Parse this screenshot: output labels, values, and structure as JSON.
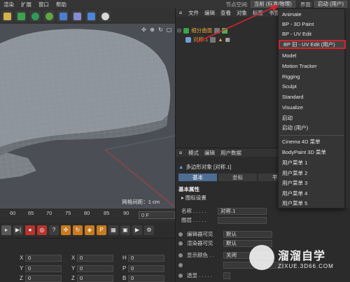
{
  "menubar": {
    "items": [
      "渲染",
      "扩展",
      "窗口",
      "帮助"
    ],
    "node_space_label": "节点空间:",
    "node_space_value": "当前 (标准/物理)",
    "layout_label": "界面:",
    "layout_value": "启动 (用户)"
  },
  "toolbar": {
    "colors": [
      "#d2b04a",
      "#3aa34b",
      "#2f9a5b",
      "#5ca73f",
      "#4a7fd1",
      "#8a8ad0",
      "#4a86d6"
    ]
  },
  "viewport": {
    "grid_info": "网格间距：1 cm",
    "nav_icons": [
      "move-icon",
      "zoom-icon",
      "rotate-icon",
      "maximize-icon"
    ]
  },
  "timeline": {
    "ticks": [
      "60",
      "65",
      "70",
      "75",
      "80",
      "85",
      "90"
    ],
    "frame_value": "0 F"
  },
  "coords": {
    "rows": [
      {
        "a1": "X",
        "v1": "0",
        "a2": "X",
        "v2": "0",
        "a3": "H",
        "v3": "0"
      },
      {
        "a1": "Y",
        "v1": "0",
        "a2": "Y",
        "v2": "0",
        "a3": "P",
        "v3": "0"
      },
      {
        "a1": "Z",
        "v1": "0",
        "a2": "Z",
        "v2": "0",
        "a3": "B",
        "v3": "0"
      }
    ]
  },
  "object_manager": {
    "menu": [
      "文件",
      "编辑",
      "查看",
      "对象",
      "标签",
      "书签"
    ],
    "objects": [
      {
        "name": "细分曲面"
      },
      {
        "name": "对称.1"
      }
    ]
  },
  "attributes": {
    "menu": [
      "模式",
      "编辑",
      "用户数据"
    ],
    "object_title": "多边形对象 [对称.1]",
    "tabs": [
      "基本",
      "坐标",
      "平滑"
    ],
    "section": "基本属性",
    "subsection": "▸ 图标设置",
    "props": [
      {
        "label": "名称 . . . . .",
        "value": "对称.1"
      },
      {
        "label": "图层 . . . . .",
        "value": ""
      },
      {
        "label": "编辑器可见",
        "value": "默认"
      },
      {
        "label": "渲染器可见",
        "value": "默认"
      },
      {
        "label": "显示颜色 . .",
        "value": "关闭"
      },
      {
        "label": "",
        "value": ""
      },
      {
        "label": "透显 . . . . .",
        "value": ""
      }
    ]
  },
  "dropdown": {
    "items": [
      "Animate",
      "BP - 3D Paint",
      "BP - UV Edit",
      "BP 旧 - UV Edit (用户)",
      "Model",
      "Motion Tracker",
      "Rigging",
      "Sculpt",
      "Standard",
      "Visualize",
      "启动",
      "启动 (用户)",
      "Cinema 4D 菜单",
      "BodyPaint 3D 菜单",
      "用户菜单 1",
      "用户菜单 2",
      "用户菜单 3",
      "用户菜单 4",
      "用户菜单 5"
    ],
    "highlighted_index": 3
  },
  "watermark": {
    "title": "溜溜自学",
    "url": "ZIXUE.3D66.COM"
  }
}
